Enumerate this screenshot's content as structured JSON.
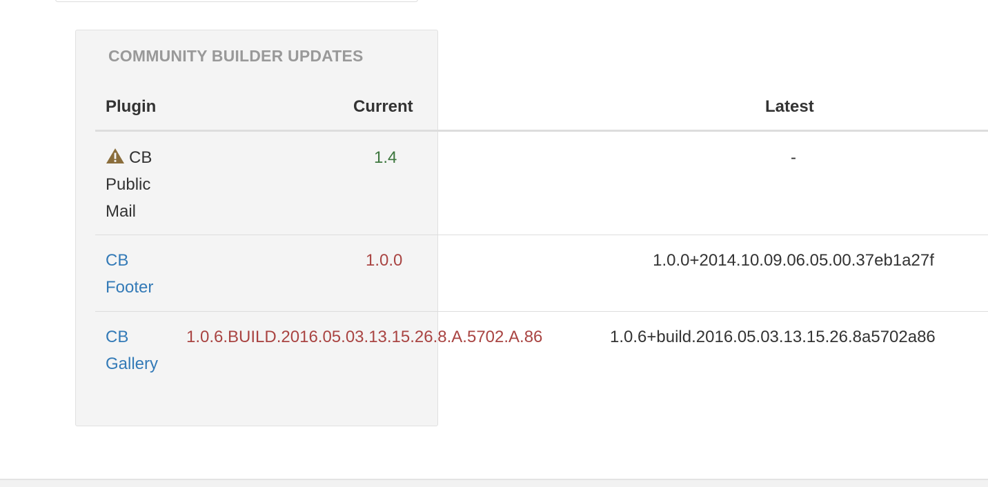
{
  "panel": {
    "title": "COMMUNITY BUILDER UPDATES"
  },
  "table": {
    "headers": {
      "plugin": "Plugin",
      "current": "Current",
      "latest": "Latest"
    },
    "rows": [
      {
        "plugin": "CB Public Mail",
        "current": "1.4",
        "latest": "-",
        "status": "warning",
        "icon": "warning-triangle-icon"
      },
      {
        "plugin": "CB Footer",
        "current": "1.0.0",
        "latest": "1.0.0+2014.10.09.06.05.00.37eb1a27f",
        "status": "outdated"
      },
      {
        "plugin": "CB Gallery",
        "current": "1.0.6.BUILD.2016.05.03.13.15.26.8.A.5702.A.86",
        "latest": "1.0.6+build.2016.05.03.13.15.26.8a5702a86",
        "status": "outdated"
      }
    ]
  },
  "colors": {
    "link": "#337ab7",
    "ok": "#3c763d",
    "outdated": "#a94442",
    "warning_icon": "#8a6d3b"
  }
}
